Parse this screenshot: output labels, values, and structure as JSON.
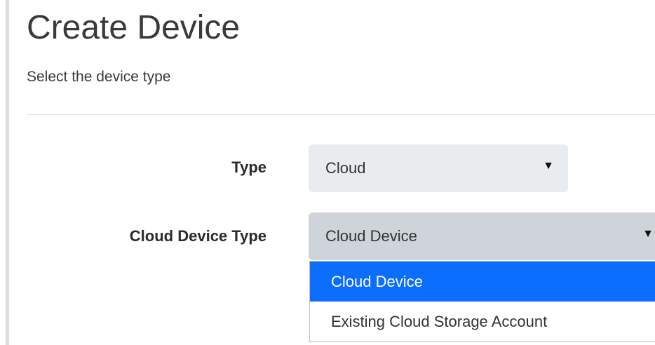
{
  "page": {
    "title": "Create Device",
    "subtitle": "Select the device type"
  },
  "form": {
    "type_label": "Type",
    "type_value": "Cloud",
    "cloud_type_label": "Cloud Device Type",
    "cloud_type_value": "Cloud Device",
    "cloud_type_options": [
      "Cloud Device",
      "Existing Cloud Storage Account"
    ],
    "highlighted_option": "Cloud Device"
  },
  "colors": {
    "highlight": "#0b6efd",
    "select_bg": "#e9ecef",
    "select_active_bg": "#ced4da"
  }
}
